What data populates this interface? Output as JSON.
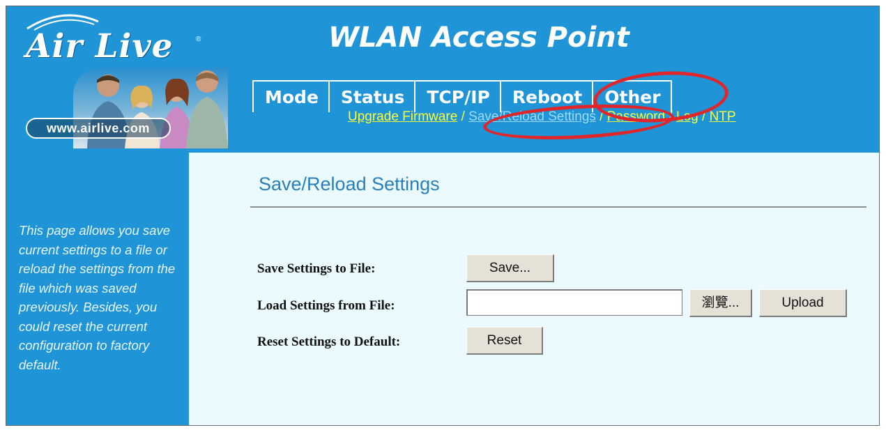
{
  "logo": {
    "text": "Air Live",
    "registered": "®",
    "url_badge": "www.airlive.com"
  },
  "header": {
    "title": "WLAN Access Point"
  },
  "tabs": [
    {
      "label": "Mode"
    },
    {
      "label": "Status"
    },
    {
      "label": "TCP/IP"
    },
    {
      "label": "Reboot"
    },
    {
      "label": "Other"
    }
  ],
  "subnav": {
    "items": [
      {
        "label": "Upgrade Firmware"
      },
      {
        "label": "Save/Reload Settings"
      },
      {
        "label": "Password"
      },
      {
        "label": "Log"
      },
      {
        "label": "NTP"
      }
    ],
    "separator": " / ",
    "active_index": 1
  },
  "sidebar": {
    "description": "This page allows you save current settings to a file or reload the settings from the file which was saved previously. Besides, you could reset the current configuration to factory default."
  },
  "main": {
    "title": "Save/Reload Settings",
    "save_label": "Save Settings to File:",
    "save_button": "Save...",
    "load_label": "Load Settings from File:",
    "load_value": "",
    "browse_button": "瀏覽...",
    "upload_button": "Upload",
    "reset_label": "Reset Settings to Default:",
    "reset_button": "Reset"
  },
  "colors": {
    "brand_blue": "#1f94d6",
    "content_bg": "#eafaff",
    "link_yellow": "#ffff33",
    "annotation_red": "#e0262b"
  }
}
